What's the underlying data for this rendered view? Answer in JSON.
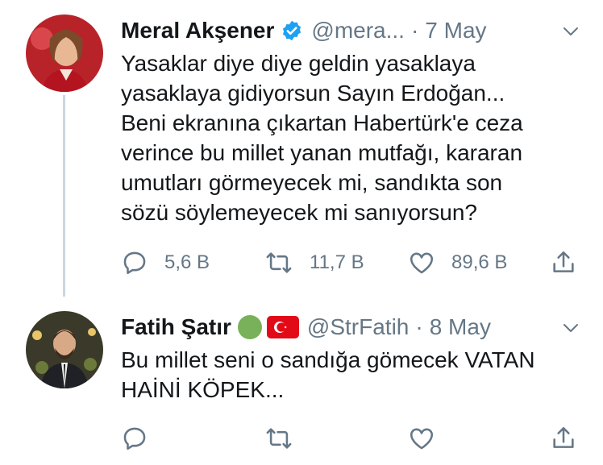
{
  "tweets": [
    {
      "name": "Meral Akşener",
      "handle": "@mera...",
      "sep": "·",
      "date": "7 May",
      "text_lines": [
        "Yasaklar diye diye geldin yasaklaya",
        "yasaklaya gidiyorsun Sayın Erdoğan...",
        "Beni ekranına çıkartan Habertürk'e ceza",
        "verince bu millet yanan mutfağı, kararan",
        "umutları görmeyecek mi, sandıkta son",
        "sözü söylemeyecek mi sanıyorsun?"
      ],
      "replies": "5,6 B",
      "retweets": "11,7 B",
      "likes": "89,6 B"
    },
    {
      "name": "Fatih Şatır",
      "handle": "@StrFatih",
      "sep": "·",
      "date": "8 May",
      "text_lines": [
        "Bu millet seni o sandığa gömecek VATAN",
        "HAİNİ KÖPEK..."
      ]
    }
  ],
  "icons": {
    "reply": "reply-icon",
    "retweet": "retweet-icon",
    "like": "heart-icon",
    "share": "share-icon",
    "verified": "verified-badge-icon",
    "caret": "chevron-down-icon"
  },
  "colors": {
    "text": "#14171a",
    "secondary": "#657786",
    "verified": "#1da1f2",
    "thread_line": "#ccd6dd"
  }
}
